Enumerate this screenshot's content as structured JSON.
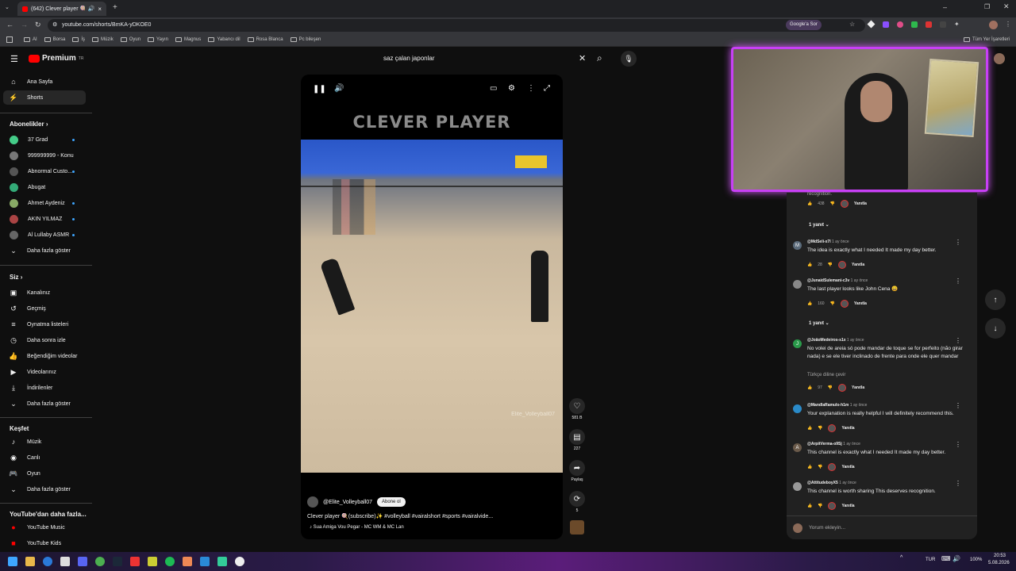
{
  "browser": {
    "tab_title": "(642) Clever player 🍭(sub...",
    "url": "youtube.com/shorts/BmKA-yDKOE0",
    "google_ask": "Google'a Sor",
    "bookmarks": [
      "AI",
      "Borsa",
      "İş",
      "Müzik",
      "Oyun",
      "Yayın",
      "Magnus",
      "Yabancı dil",
      "Rosa Blanca",
      "Pc bileşen"
    ],
    "all_bookmarks": "Tüm Yer İşaretleri"
  },
  "youtube": {
    "logo": "Premium",
    "logo_sup": "TR",
    "search_value": "saz çalan japonlar",
    "nav": [
      {
        "label": "Ana Sayfa",
        "icon": "home-icon"
      },
      {
        "label": "Shorts",
        "icon": "shorts-icon"
      }
    ],
    "subs_header": "Abonelikler",
    "subs": [
      {
        "label": "37 Grad"
      },
      {
        "label": "999999999 - Konu"
      },
      {
        "label": "Abnormal Custo..."
      },
      {
        "label": "Abugat"
      },
      {
        "label": "Ahmet Aydeniz"
      },
      {
        "label": "AKIN YILMAZ"
      },
      {
        "label": "Al Lullaby ASMR"
      }
    ],
    "show_more": "Daha fazla göster",
    "you_header": "Siz",
    "you_items": [
      "Kanalınız",
      "Geçmiş",
      "Oynatma listeleri",
      "Daha sonra izle",
      "Beğendiğim videolar",
      "Videolarınız",
      "İndirilenler"
    ],
    "explore_header": "Keşfet",
    "explore_items": [
      "Müzik",
      "Canlı",
      "Oyun"
    ],
    "more_header": "YouTube'dan daha fazla...",
    "more_items": [
      "YouTube Music",
      "YouTube Kids"
    ]
  },
  "short": {
    "brand_text": "CLEVER PLAYER",
    "watermark": "Elite_Volleyball07",
    "channel": "@Elite_Volleyball07",
    "subscribe": "Abone ol",
    "description": "Clever player 🍭(subscribe)✨ #volleyball #vairalshort #sports #vairalvide...",
    "music": "♪ Sua Amiga Vou Pegar - MC WM & MC Lan",
    "likes": "581 B",
    "comments_count": "227",
    "share": "Paylaş",
    "remix_count": "5"
  },
  "comments": [
    {
      "user": "",
      "time": "",
      "text": "recognition.",
      "likes": "438",
      "reply": "Yanıtla",
      "replies": "1 yanıt"
    },
    {
      "user": "@MdSeli-x7l",
      "time": "1 ay önce",
      "text": "The idea is exactly what I needed It made my day better.",
      "likes": "28",
      "reply": "Yanıtla"
    },
    {
      "user": "@JunaidSulemani-c3v",
      "time": "1 ay önce",
      "text": "The last player looks like John Cena 😄",
      "likes": "160",
      "reply": "Yanıtla",
      "replies": "1 yanıt"
    },
    {
      "user": "@JoãoMedeiros-s1x",
      "time": "1 ay önce",
      "text": "No volei de areia só pode mandar de toque se for perfeito (não girar nada) e se ele tiver inclinado de frente para onde ele quer mandar",
      "translate": "Türkçe diline çevir",
      "likes": "97",
      "reply": "Yanıtla"
    },
    {
      "user": "@MandlaRamulo-h1m",
      "time": "1 ay önce",
      "text": "Your explanation is really helpful I will definitely recommend this.",
      "likes": "",
      "reply": "Yanıtla"
    },
    {
      "user": "@ArpitVerma-o9Sj",
      "time": "1 ay önce",
      "text": "This channel is exactly what I needed It made my day better.",
      "likes": "",
      "reply": "Yanıtla"
    },
    {
      "user": "@AttitudeboyX5",
      "time": "1 ay önce",
      "text": "This channel is worth sharing This deserves recognition.",
      "likes": "",
      "reply": "Yanıtla"
    }
  ],
  "add_comment": "Yorum ekleyin...",
  "taskbar": {
    "lang": "TUR",
    "battery": "100%",
    "time": "20:53",
    "date": "5.08.2026"
  }
}
